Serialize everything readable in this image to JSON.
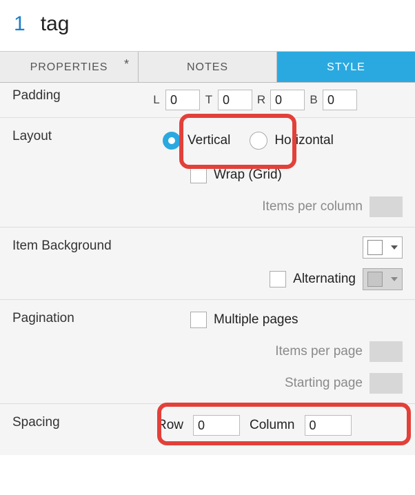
{
  "header": {
    "index": "1",
    "title": "tag"
  },
  "tabs": {
    "properties": "PROPERTIES",
    "properties_dirty": "*",
    "notes": "NOTES",
    "style": "STYLE"
  },
  "padding": {
    "label": "Padding",
    "left_label": "L",
    "left_value": "0",
    "top_label": "T",
    "top_value": "0",
    "right_label": "R",
    "right_value": "0",
    "bottom_label": "B",
    "bottom_value": "0"
  },
  "layout": {
    "label": "Layout",
    "vertical_label": "Vertical",
    "horizontal_label": "Horizontal",
    "wrap_label": "Wrap (Grid)",
    "items_per_column_label": "Items per column"
  },
  "itembg": {
    "label": "Item Background",
    "alternating_label": "Alternating"
  },
  "pagination": {
    "label": "Pagination",
    "multiple_label": "Multiple pages",
    "items_per_page_label": "Items per page",
    "starting_page_label": "Starting page"
  },
  "spacing": {
    "label": "Spacing",
    "row_label": "Row",
    "row_value": "0",
    "column_label": "Column",
    "column_value": "0"
  }
}
